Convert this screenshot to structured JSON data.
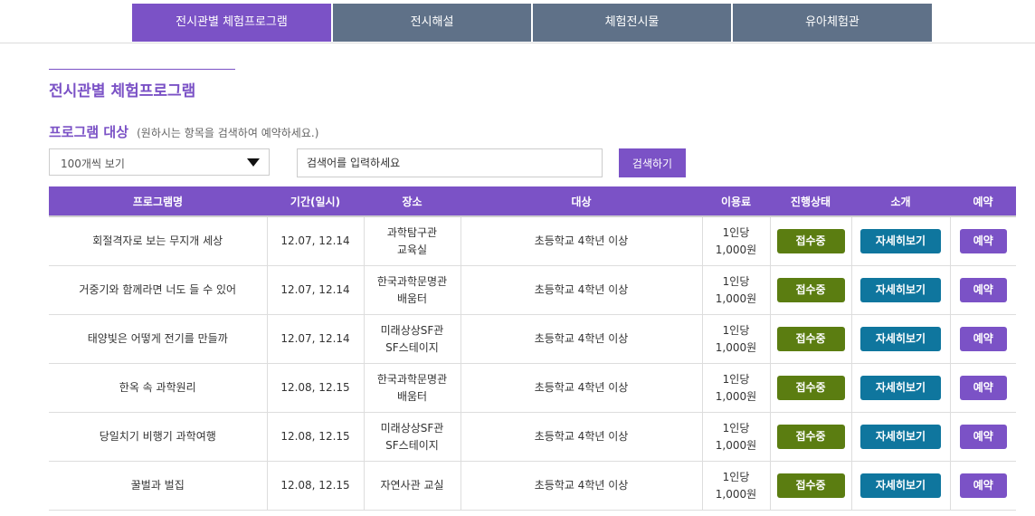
{
  "tabs": [
    {
      "label": "전시관별 체험프로그램",
      "active": true
    },
    {
      "label": "전시해설",
      "active": false
    },
    {
      "label": "체험전시물",
      "active": false
    },
    {
      "label": "유아체험관",
      "active": false
    }
  ],
  "page_title": "전시관별 체험프로그램",
  "target": {
    "label": "프로그램 대상",
    "hint": "(원하시는 항목을 검색하여 예약하세요.)"
  },
  "filter": {
    "page_size_selected": "100개씩 보기"
  },
  "search": {
    "placeholder": "검색어를 입력하세요",
    "button_label": "검색하기"
  },
  "table": {
    "columns": [
      "프로그램명",
      "기간(일시)",
      "장소",
      "대상",
      "이용료",
      "진행상태",
      "소개",
      "예약"
    ],
    "rows": [
      {
        "name": "회절격자로 보는 무지개 세상",
        "period": "12.07, 12.14",
        "place": [
          "과학탐구관",
          "교육실"
        ],
        "target": "초등학교 4학년 이상",
        "fee": [
          "1인당",
          "1,000원"
        ],
        "status": "접수중",
        "detail": "자세히보기",
        "reserve": "예약"
      },
      {
        "name": "거중기와 함께라면 너도 들 수 있어",
        "period": "12.07, 12.14",
        "place": [
          "한국과학문명관",
          "배움터"
        ],
        "target": "초등학교 4학년 이상",
        "fee": [
          "1인당",
          "1,000원"
        ],
        "status": "접수중",
        "detail": "자세히보기",
        "reserve": "예약"
      },
      {
        "name": "태양빛은 어떻게 전기를 만들까",
        "period": "12.07, 12.14",
        "place": [
          "미래상상SF관",
          "SF스테이지"
        ],
        "target": "초등학교 4학년 이상",
        "fee": [
          "1인당",
          "1,000원"
        ],
        "status": "접수중",
        "detail": "자세히보기",
        "reserve": "예약"
      },
      {
        "name": "한옥 속 과학원리",
        "period": "12.08, 12.15",
        "place": [
          "한국과학문명관",
          "배움터"
        ],
        "target": "초등학교 4학년 이상",
        "fee": [
          "1인당",
          "1,000원"
        ],
        "status": "접수중",
        "detail": "자세히보기",
        "reserve": "예약"
      },
      {
        "name": "당일치기 비행기 과학여행",
        "period": "12.08, 12.15",
        "place": [
          "미래상상SF관",
          "SF스테이지"
        ],
        "target": "초등학교 4학년 이상",
        "fee": [
          "1인당",
          "1,000원"
        ],
        "status": "접수중",
        "detail": "자세히보기",
        "reserve": "예약"
      },
      {
        "name": "꿀벌과 벌집",
        "period": "12.08, 12.15",
        "place": [
          "자연사관 교실"
        ],
        "target": "초등학교 4학년 이상",
        "fee": [
          "1인당",
          "1,000원"
        ],
        "status": "접수중",
        "detail": "자세히보기",
        "reserve": "예약"
      }
    ]
  },
  "colors": {
    "accent": "#7b52c6",
    "tab_inactive": "#5f7188",
    "status_open": "#5b7d11",
    "detail": "#0f769e"
  }
}
